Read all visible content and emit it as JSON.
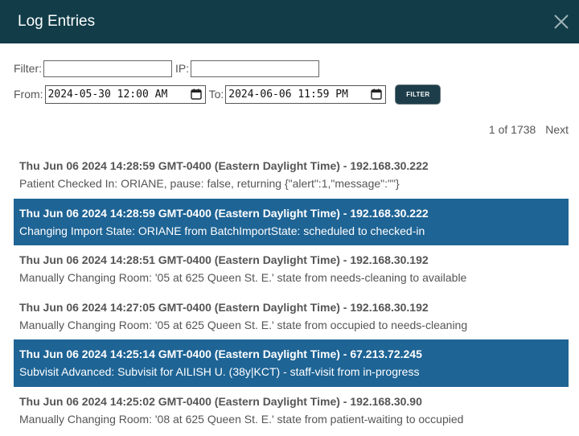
{
  "window": {
    "title": "Log Entries"
  },
  "filters": {
    "filter_label": "Filter:",
    "filter_value": "",
    "ip_label": "IP:",
    "ip_value": "",
    "from_label": "From:",
    "from_value": "2024-05-30 12:00 AM",
    "to_label": "To:",
    "to_value": "2024-06-06 11:59 PM",
    "filter_button": "FILTER"
  },
  "pager": {
    "position": "1 of 1738",
    "next_label": "Next"
  },
  "entries": [
    {
      "header": "Thu Jun 06 2024 14:28:59 GMT-0400 (Eastern Daylight Time) - 192.168.30.222",
      "message": "Patient Checked In: ORIANE, pause: false, returning {\"alert\":1,\"message\":\"\"}",
      "highlighted": false
    },
    {
      "header": "Thu Jun 06 2024 14:28:59 GMT-0400 (Eastern Daylight Time) - 192.168.30.222",
      "message": "Changing Import State: ORIANE from BatchImportState: scheduled to checked-in",
      "highlighted": true
    },
    {
      "header": "Thu Jun 06 2024 14:28:51 GMT-0400 (Eastern Daylight Time) - 192.168.30.192",
      "message": "Manually Changing Room: '05 at 625 Queen St. E.' state from needs-cleaning to available",
      "highlighted": false
    },
    {
      "header": "Thu Jun 06 2024 14:27:05 GMT-0400 (Eastern Daylight Time) - 192.168.30.192",
      "message": "Manually Changing Room: '05 at 625 Queen St. E.' state from occupied to needs-cleaning",
      "highlighted": false
    },
    {
      "header": "Thu Jun 06 2024 14:25:14 GMT-0400 (Eastern Daylight Time) - 67.213.72.245",
      "message": "Subvisit Advanced: Subvisit for AILISH U. (38y|KCT) - staff-visit from in-progress",
      "highlighted": true
    },
    {
      "header": "Thu Jun 06 2024 14:25:02 GMT-0400 (Eastern Daylight Time) - 192.168.30.90",
      "message": "Manually Changing Room: '08 at 625 Queen St. E.' state from patient-waiting to occupied",
      "highlighted": false
    }
  ],
  "colors": {
    "header_bg": "#113c48",
    "highlight_bg": "#1e6495"
  },
  "icons": {
    "close": "close-icon",
    "calendar": "calendar-icon"
  }
}
